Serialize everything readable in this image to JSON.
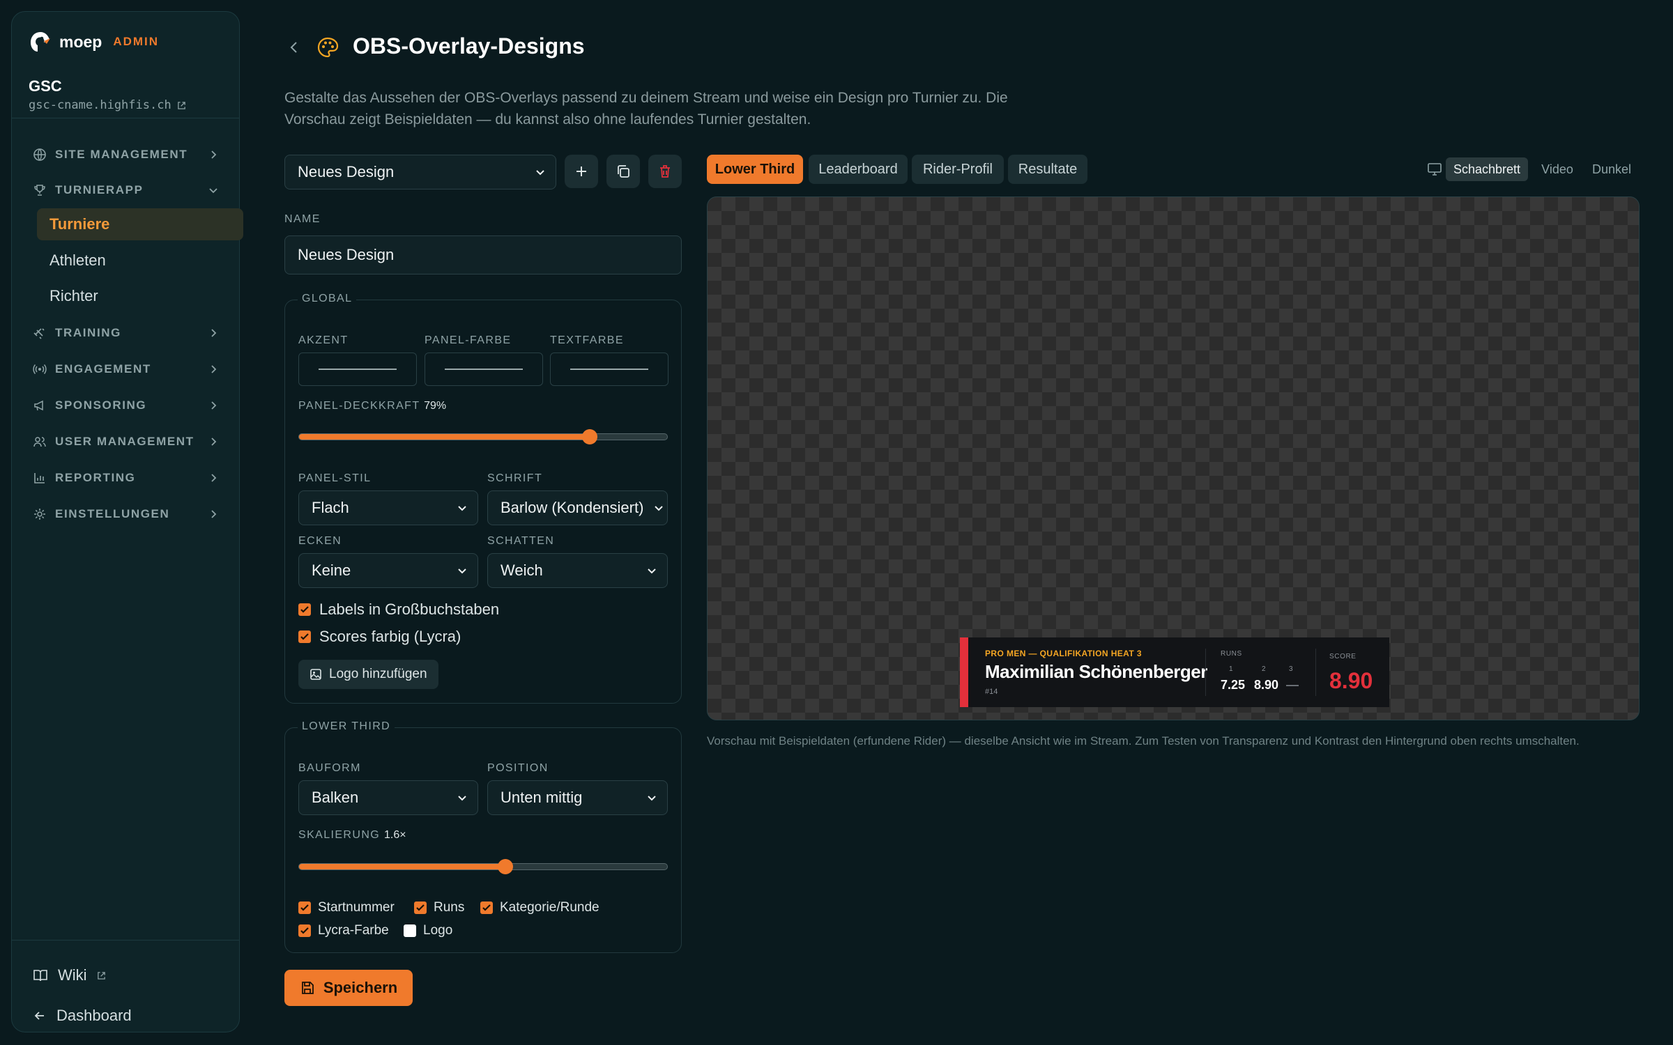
{
  "sidebar": {
    "brand": "moep",
    "badge": "ADMIN",
    "tenant": "GSC",
    "host": "gsc-cname.highfis.ch",
    "sections": {
      "site_management": "SITE MANAGEMENT",
      "turnierapp": "TURNIERAPP",
      "training": "TRAINING",
      "engagement": "ENGAGEMENT",
      "sponsoring": "SPONSORING",
      "user_management": "USER MANAGEMENT",
      "reporting": "REPORTING",
      "einstellungen": "EINSTELLUNGEN"
    },
    "sub": {
      "turniere": "Turniere",
      "athleten": "Athleten",
      "richter": "Richter"
    },
    "footer": {
      "wiki": "Wiki",
      "dashboard": "Dashboard"
    }
  },
  "header": {
    "title": "OBS-Overlay-Designs",
    "description": "Gestalte das Aussehen der OBS-Overlays passend zu deinem Stream und weise ein Design pro Turnier zu. Die Vorschau zeigt Beispieldaten — du kannst also ohne laufendes Turnier gestalten."
  },
  "editor": {
    "design_select": "Neues Design",
    "name_label": "NAME",
    "name_value": "Neues Design",
    "global": {
      "legend": "GLOBAL",
      "akzent": "AKZENT",
      "panel_farbe": "PANEL-FARBE",
      "textfarbe": "TEXTFARBE",
      "deckkraft_label": "PANEL-DECKKRAFT",
      "deckkraft_value": "79%",
      "deckkraft_fraction": 0.79,
      "panel_stil_label": "PANEL-STIL",
      "panel_stil": "Flach",
      "schrift_label": "SCHRIFT",
      "schrift": "Barlow (Kondensiert)",
      "ecken_label": "ECKEN",
      "ecken": "Keine",
      "schatten_label": "SCHATTEN",
      "schatten": "Weich",
      "uppercase_label": "Labels in Großbuchstaben",
      "scores_label": "Scores farbig (Lycra)",
      "logo_button": "Logo hinzufügen"
    },
    "lower_third": {
      "legend": "LOWER THIRD",
      "bauform_label": "BAUFORM",
      "bauform": "Balken",
      "position_label": "POSITION",
      "position": "Unten mittig",
      "skalierung_label": "SKALIERUNG",
      "skalierung_value": "1.6×",
      "skalierung_fraction": 0.56,
      "opt_startnummer": "Startnummer",
      "opt_runs": "Runs",
      "opt_kategorie": "Kategorie/Runde",
      "opt_lycra": "Lycra-Farbe",
      "opt_logo": "Logo"
    },
    "save": "Speichern"
  },
  "preview": {
    "tabs": {
      "lower_third": "Lower Third",
      "leaderboard": "Leaderboard",
      "rider_profil": "Rider-Profil",
      "resultate": "Resultate"
    },
    "backgrounds": {
      "schachbrett": "Schachbrett",
      "video": "Video",
      "dunkel": "Dunkel"
    },
    "overlay": {
      "category": "PRO MEN — QUALIFIKATION HEAT 3",
      "rider": "Maximilian Schönenberger",
      "number": "#14",
      "runs_label": "RUNS",
      "run_idx_1": "1",
      "run_idx_2": "2",
      "run_idx_3": "3",
      "run_1": "7.25",
      "run_2": "8.90",
      "run_3": "—",
      "score_label": "SCORE",
      "score": "8.90"
    },
    "note": "Vorschau mit Beispieldaten (erfundene Rider) — dieselbe Ansicht wie im Stream. Zum Testen von Transparenz und Kontrast den Hintergrund oben rechts umschalten."
  },
  "colors": {
    "accent": "#f07a2c",
    "background": "#0a1a1e",
    "sidebar": "#0e2428",
    "overlay_bar": "#e3303b",
    "overlay_category": "#f5a623"
  }
}
